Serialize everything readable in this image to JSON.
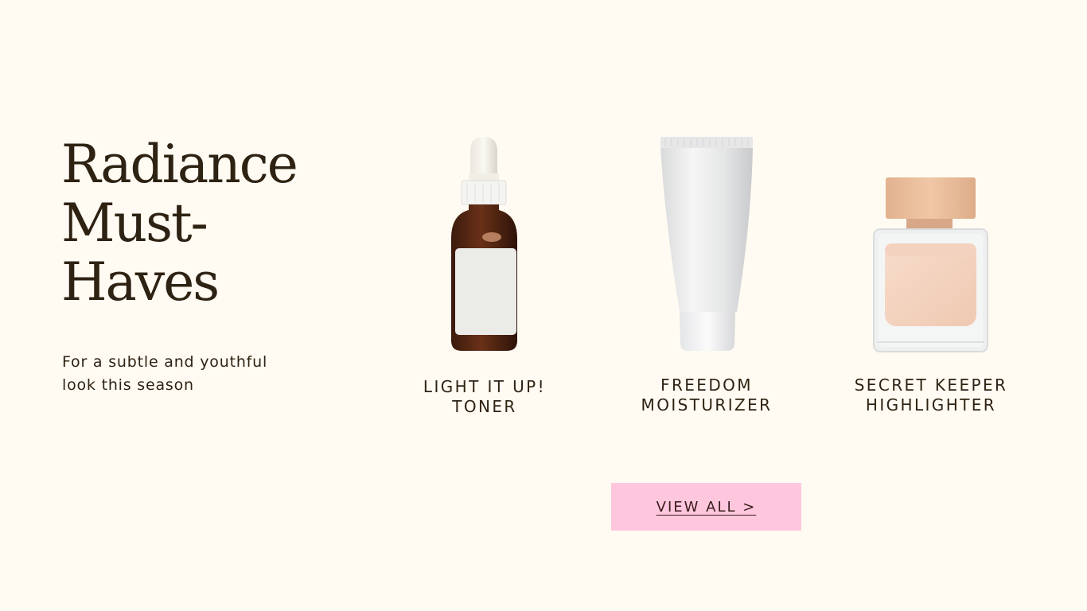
{
  "hero": {
    "headline_lines": [
      "Radiance",
      "Must-",
      "Haves"
    ],
    "subtitle_lines": [
      "For a subtle and youthful",
      "look this season"
    ]
  },
  "products": [
    {
      "name_lines": [
        "LIGHT IT UP!",
        "TONER"
      ],
      "icon": "dropper-bottle-icon"
    },
    {
      "name_lines": [
        "FREEDOM",
        "MOISTURIZER"
      ],
      "icon": "cream-tube-icon"
    },
    {
      "name_lines": [
        "SECRET KEEPER",
        "HIGHLIGHTER"
      ],
      "icon": "square-glass-bottle-icon"
    }
  ],
  "cta": {
    "label": "VIEW ALL >"
  },
  "colors": {
    "background": "#fffbf3",
    "text": "#2e2212",
    "button": "#ffc7de"
  }
}
